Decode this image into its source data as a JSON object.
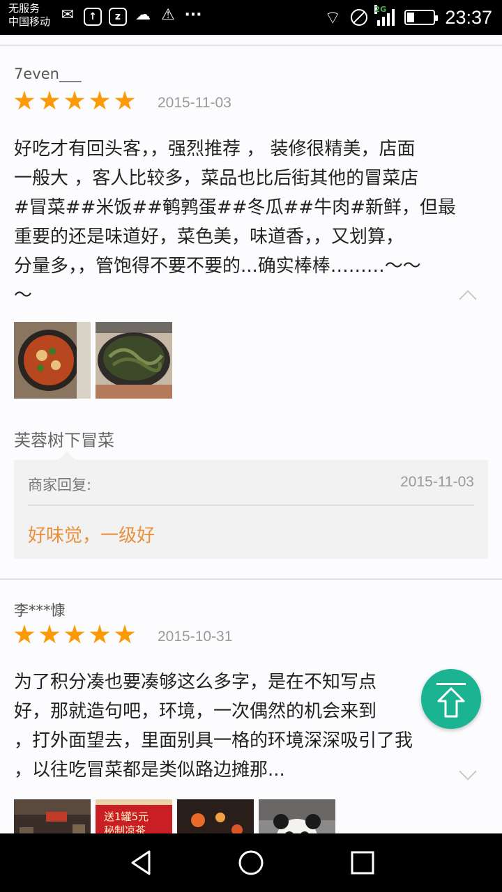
{
  "status_bar": {
    "carrier_line1": "无服务",
    "carrier_line2": "中国移动",
    "network_type": "2G",
    "time": "23:37",
    "icons": [
      "message-icon",
      "upload-icon",
      "z-app-icon",
      "wechat-icon",
      "clean-icon",
      "more-dots-icon",
      "wifi-icon",
      "no-disturb-icon",
      "signal-icon",
      "battery-icon"
    ]
  },
  "reviews": [
    {
      "username": "7even___",
      "rating": 5,
      "date": "2015-11-03",
      "text": "好吃才有回头客，，强烈推荐 ，  装修很精美，店面\n一般大  ，客人比较多，菜品也比后街其他的冒菜店\n#冒菜##米饭##鹌鹑蛋##冬瓜##牛肉#新鲜，但最\n重要的还是味道好，菜色美，味道香，，又划算，\n分量多，，管饱得不要不要的...确实棒棒………～～\n～",
      "photos": [
        "food-photo-spicy-pot",
        "food-photo-greens"
      ],
      "shop_name": "芙蓉树下冒菜",
      "reply": {
        "label": "商家回复:",
        "date": "2015-11-03",
        "text": "好味觉，一级好"
      }
    },
    {
      "username": "李***慷",
      "rating": 5,
      "date": "2015-10-31",
      "text": "为了积分凑也要凑够这么多字，是在不知写点\n好，那就造句吧，环境，一次偶然的机会来到\n，打外面望去，里面别具一格的环境深深吸引了我\n，以往吃冒菜都是类似路边摊那...",
      "photos": [
        "photo-restaurant-interior",
        "photo-promo-sign",
        "photo-night-lights",
        "photo-panda-mascot"
      ],
      "promo_text": "送1罐5元\n秘制凉茶"
    }
  ],
  "colors": {
    "star": "#fb9a06",
    "reply_text": "#e8903a",
    "fab": "#1bb493"
  },
  "nav_bar": {
    "buttons": [
      "back-icon",
      "home-icon",
      "recents-icon"
    ]
  }
}
